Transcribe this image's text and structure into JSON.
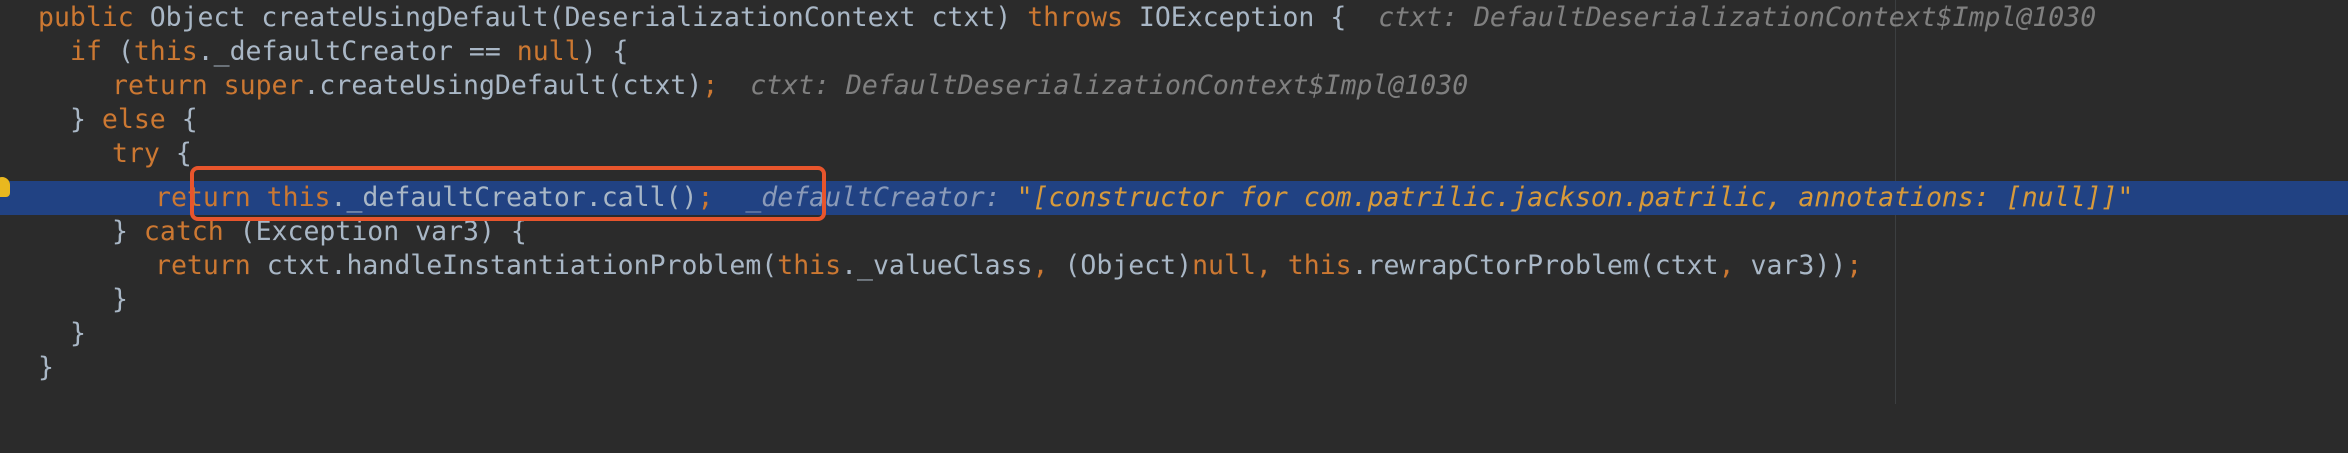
{
  "code": {
    "line1": {
      "t1": "public ",
      "t2": "Object createUsingDefault(DeserializationContext ctxt) ",
      "t3": "throws ",
      "t4": "IOException {",
      "hint": "ctxt: DefaultDeserializationContext$Impl@1030"
    },
    "line2": {
      "t1": "if ",
      "t2": "(",
      "t3": "this",
      "t4": "._defaultCreator == ",
      "t5": "null",
      "t6": ") {"
    },
    "line3": {
      "t1": "return super",
      "t2": ".createUsingDefault(ctxt)",
      "t3": ";",
      "hint": "ctxt: DefaultDeserializationContext$Impl@1030"
    },
    "line4": {
      "t1": "} ",
      "t2": "else ",
      "t3": "{"
    },
    "line5": {
      "t1": "try ",
      "t2": "{"
    },
    "line6": {
      "t1": "return this",
      "t2": "._defaultCreator.call()",
      "t3": ";",
      "hint_label": "_defaultCreator: ",
      "hint_value": "\"[constructor for com.patrilic.jackson.patrilic, annotations: [null]]\""
    },
    "line7": {
      "t1": "} ",
      "t2": "catch ",
      "t3": "(Exception var3) {"
    },
    "line8": {
      "t1": "return ",
      "t2": "ctxt.handleInstantiationProblem(",
      "t3": "this",
      "t4": "._valueClass",
      "t5": ", ",
      "t6": "(Object)",
      "t7": "null, this",
      "t8": ".rewrapCtorProblem(ctxt",
      "t9": ", ",
      "t10": "var3))",
      "t11": ";"
    },
    "line9": {
      "t1": "}"
    },
    "line10": {
      "t1": "}"
    },
    "line11": {
      "t1": "}"
    }
  },
  "colors": {
    "background": "#2b2b2b",
    "keyword": "#cc7832",
    "text": "#a9b7c6",
    "hint": "#808080",
    "active_line": "#214283",
    "annotation_box": "#e8552c",
    "string_value": "#d89a3a"
  },
  "icons": {
    "gutter": "lightbulb-icon"
  }
}
